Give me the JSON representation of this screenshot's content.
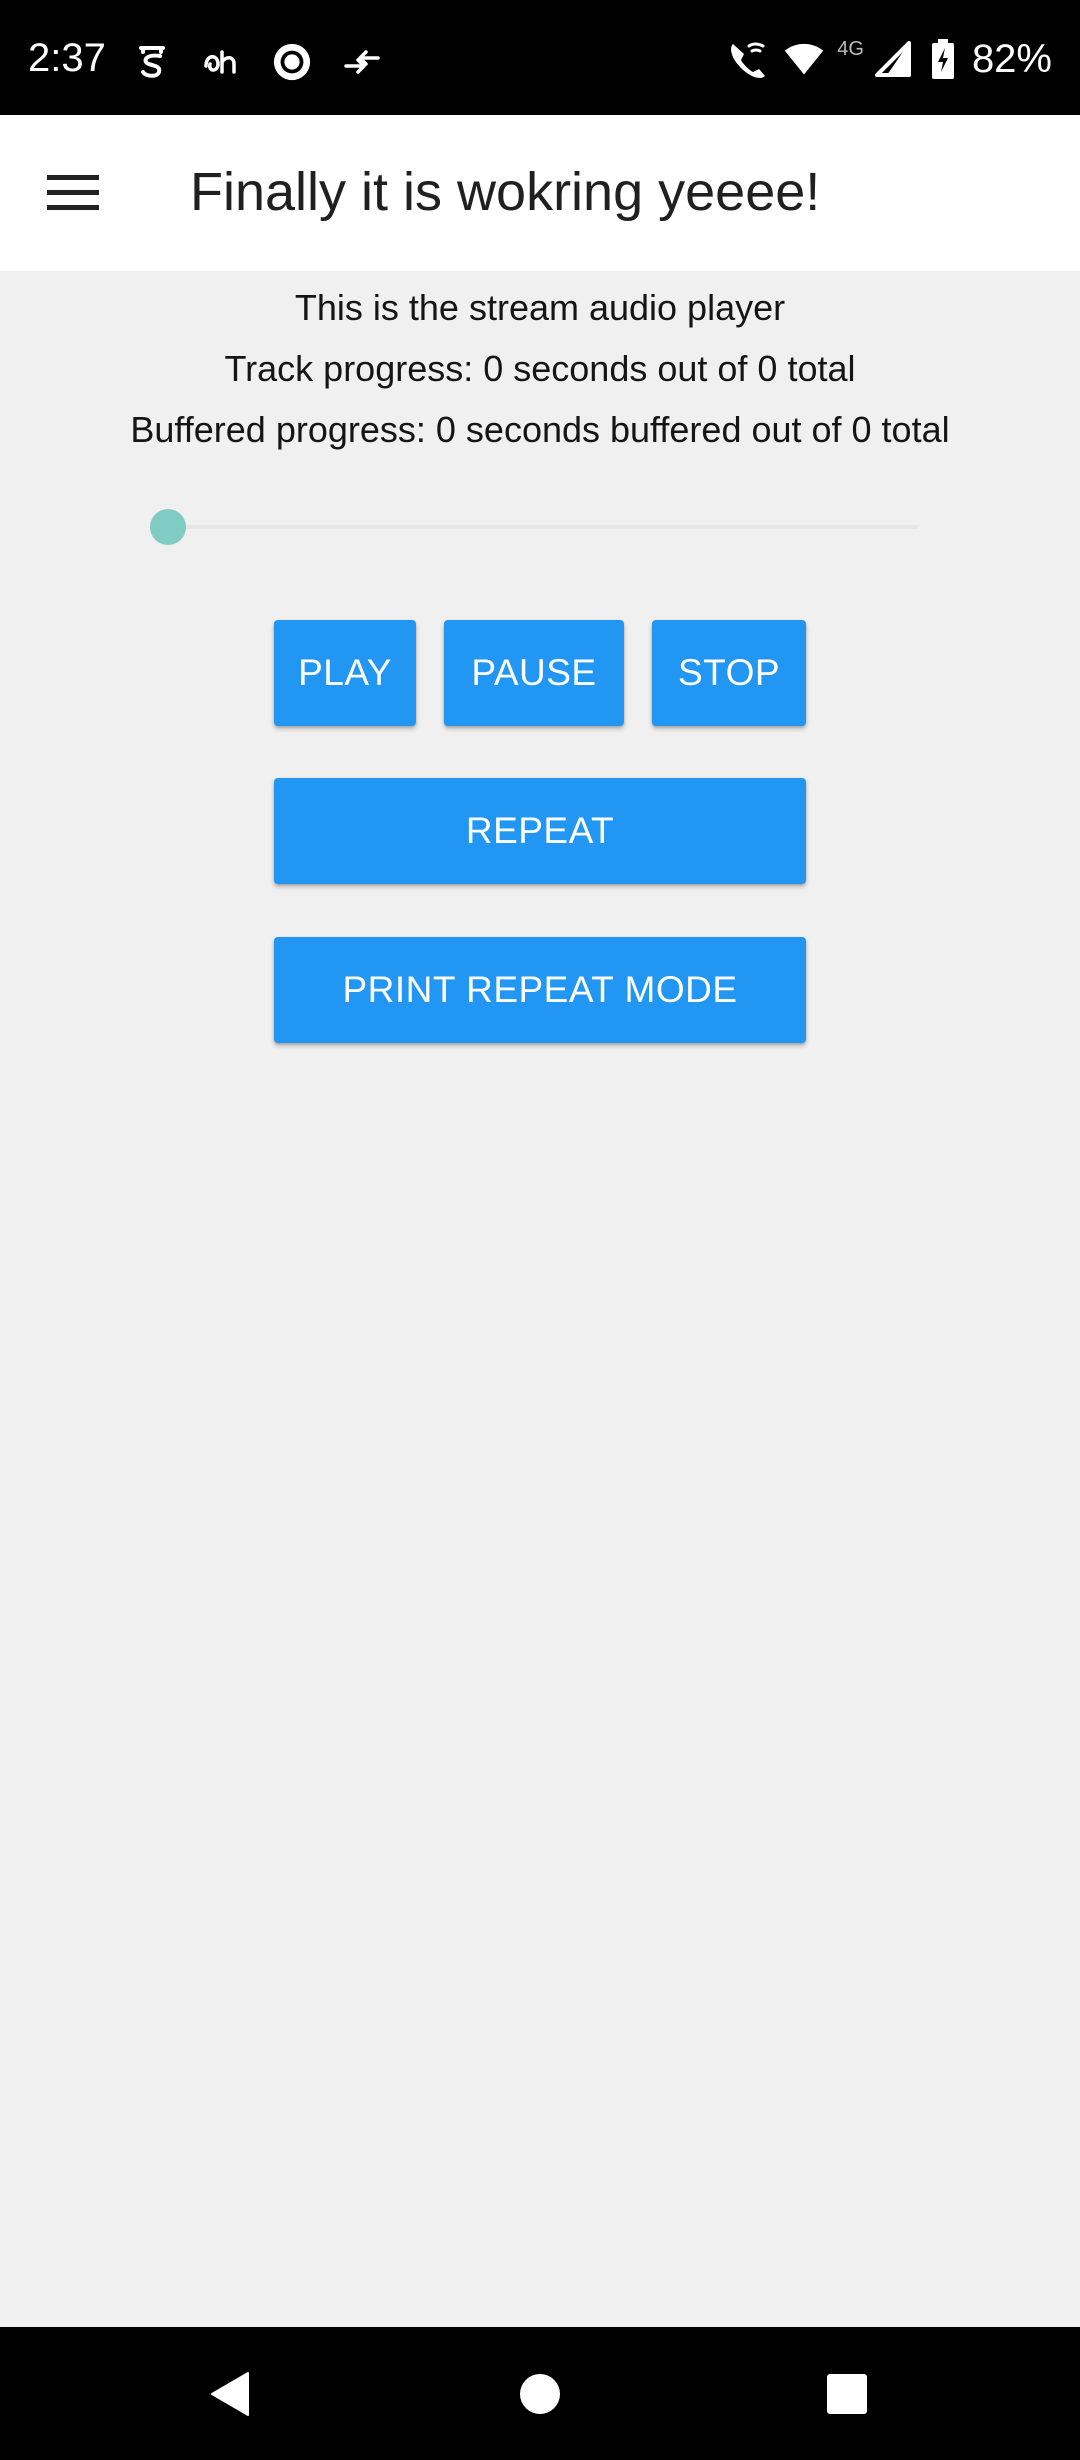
{
  "status_bar": {
    "time": "2:37",
    "network_type": "4G",
    "battery_percent": "82%",
    "left_icons": [
      "notification-s-icon",
      "notification-script-icon",
      "record-circle-icon",
      "data-transfer-icon"
    ],
    "right_icons": [
      "wifi-calling-icon",
      "wifi-icon",
      "cell-signal-icon",
      "battery-charging-icon"
    ]
  },
  "app_bar": {
    "menu_icon": "hamburger-menu-icon",
    "title": "Finally it is wokring yeeee!"
  },
  "player": {
    "heading": "This is the stream audio player",
    "track_progress": "Track progress: 0 seconds out of 0 total",
    "buffered_progress": "Buffered progress: 0 seconds buffered out of 0 total",
    "slider_value": 0,
    "accent_color": "#80cbc4"
  },
  "controls": {
    "play_label": "PLAY",
    "pause_label": "PAUSE",
    "stop_label": "STOP",
    "repeat_label": "REPEAT",
    "print_repeat_mode_label": "PRINT REPEAT MODE",
    "button_color": "#2196f3"
  },
  "nav_bar": {
    "icons": [
      "back-icon",
      "home-icon",
      "recents-icon"
    ]
  }
}
